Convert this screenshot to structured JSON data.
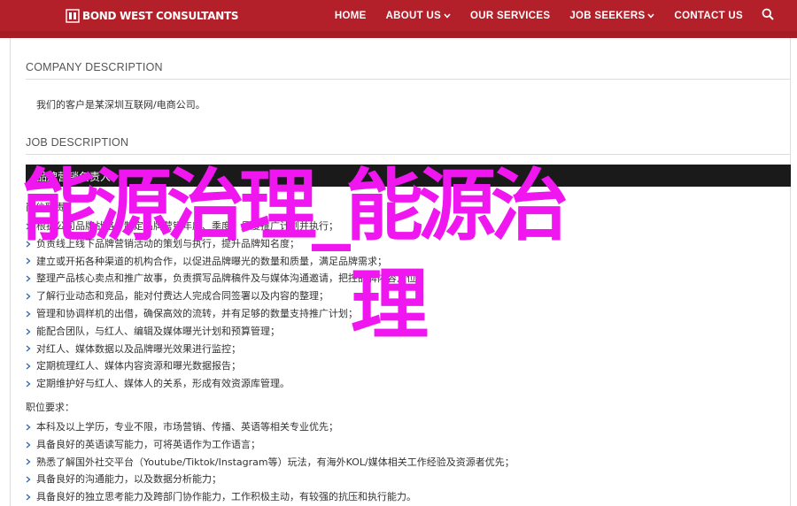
{
  "header": {
    "brand": "BOND WEST CONSULTANTS",
    "nav": [
      {
        "label": "HOME",
        "has_dropdown": false
      },
      {
        "label": "ABOUT US",
        "has_dropdown": true
      },
      {
        "label": "OUR SERVICES",
        "has_dropdown": false
      },
      {
        "label": "JOB SEEKERS",
        "has_dropdown": true
      },
      {
        "label": "CONTACT US",
        "has_dropdown": false
      }
    ],
    "search_icon": "search-icon",
    "colors": {
      "bar": "#b3202a",
      "text": "#ffffff"
    }
  },
  "company": {
    "title": "COMPANY DESCRIPTION",
    "text": "我们的客户是某深圳互联网/电商公司。"
  },
  "job": {
    "title": "JOB DESCRIPTION",
    "position": "品牌营销负责人",
    "duties_label": "岗位职责：",
    "duties": [
      "根据公司品牌战略，制定品牌营销年度、季度、月度推广计划并执行；",
      "负责线上线下品牌营销活动的策划与执行，提升品牌知名度；",
      "建立或开拓各种渠道的机构合作，以促进品牌曝光的数量和质量，满足品牌需求；",
      "整理产品核心卖点和推广故事，负责撰写品牌稿件及与媒体沟通邀请，把控品牌内容定位；",
      "了解行业动态和竞品，能对付费达人完成合同签署以及内容的整理；",
      "管理和协调样机的出借，确保高效的流转，并有足够的数量支持推广计划；",
      "能配合团队，与红人、编辑及媒体曝光计划和预算管理；",
      "对红人、媒体数据以及品牌曝光效果进行监控；",
      "定期梳理红人、媒体内容资源和曝光数据报告；",
      "定期维护好与红人、媒体人的关系，形成有效资源库管理。"
    ],
    "requirements_label": "职位要求：",
    "requirements": [
      "本科及以上学历，专业不限，市场营销、传播、英语等相关专业优先；",
      "具备良好的英语读写能力，可将英语作为工作语言；",
      "熟悉了解国外社交平台（Youtube/Tiktok/Instagram等）玩法，有海外KOL/媒体相关工作经验及资源者优先；",
      "具备良好的沟通能力，以及数据分析能力；",
      "具备良好的独立思考能力及跨部门协作能力，工作积极主动，有较强的抗压和执行能力。"
    ]
  },
  "overlay": {
    "line1": "能源治理_能源治",
    "line2": "理",
    "color": "#f016f0"
  }
}
